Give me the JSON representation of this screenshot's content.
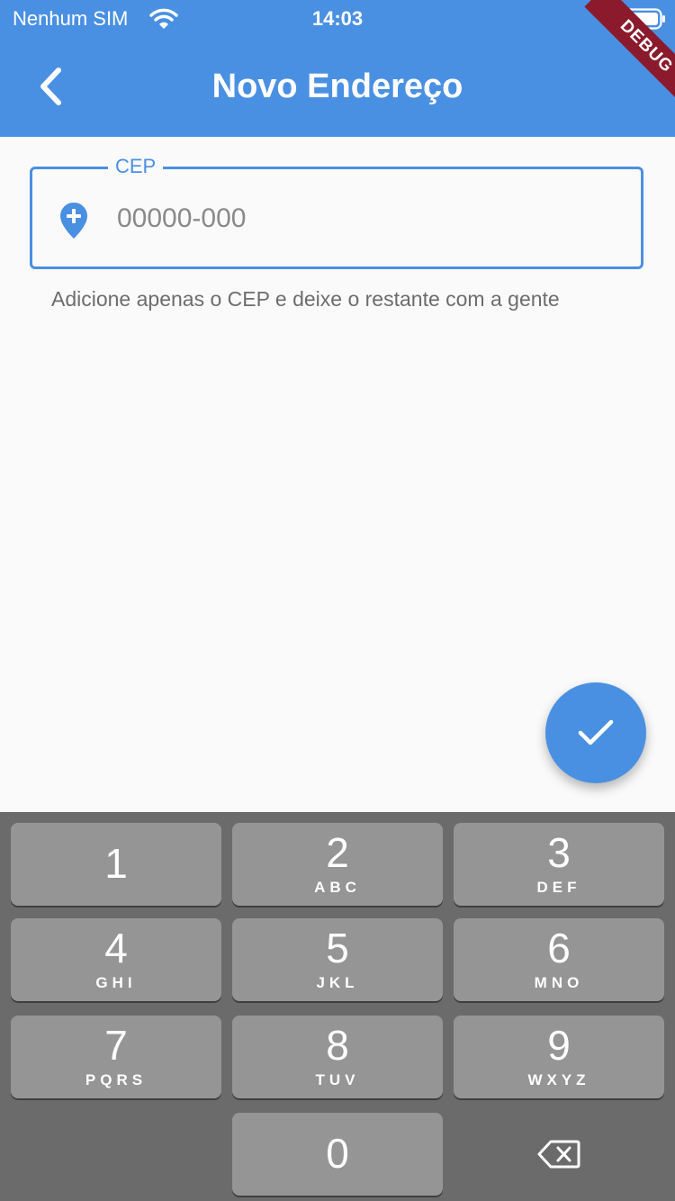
{
  "status_bar": {
    "carrier": "Nenhum SIM",
    "time": "14:03"
  },
  "app_bar": {
    "title": "Novo Endereço",
    "debug_banner": "DEBUG"
  },
  "form": {
    "cep_label": "CEP",
    "cep_placeholder": "00000-000",
    "cep_value": "",
    "helper_text": "Adicione apenas o CEP e deixe o restante com a gente"
  },
  "fab": {
    "icon": "check-icon"
  },
  "keypad": {
    "keys": [
      {
        "digit": "1",
        "letters": ""
      },
      {
        "digit": "2",
        "letters": "ABC"
      },
      {
        "digit": "3",
        "letters": "DEF"
      },
      {
        "digit": "4",
        "letters": "GHI"
      },
      {
        "digit": "5",
        "letters": "JKL"
      },
      {
        "digit": "6",
        "letters": "MNO"
      },
      {
        "digit": "7",
        "letters": "PQRS"
      },
      {
        "digit": "8",
        "letters": "TUV"
      },
      {
        "digit": "9",
        "letters": "WXYZ"
      },
      {
        "digit": "0",
        "letters": ""
      }
    ]
  },
  "colors": {
    "primary": "#4a90e2",
    "background": "#fafafa",
    "keyboard_background": "#6b6b6b",
    "key_background": "#959595",
    "debug_ribbon": "#8b1a2d"
  }
}
